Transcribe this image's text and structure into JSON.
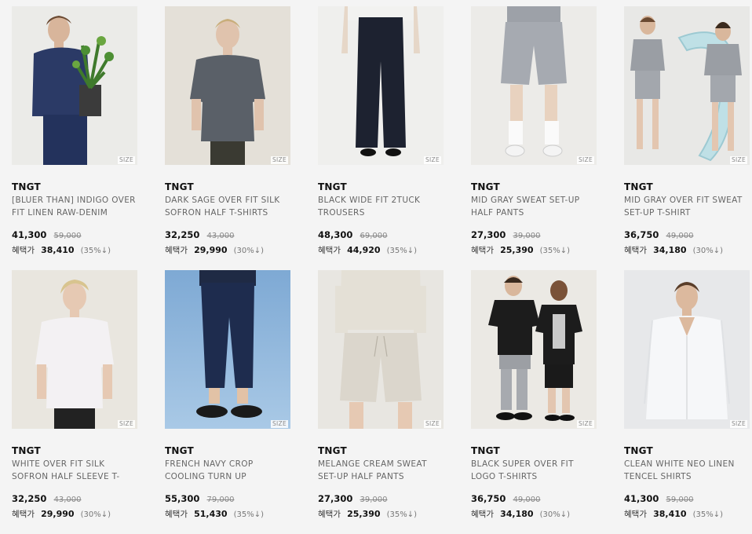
{
  "size_label": "SIZE",
  "products": [
    {
      "brand": "TNGT",
      "name_line1": "[BLUER THAN] INDIGO OVER",
      "name_line2": "FIT LINEN RAW-DENIM",
      "price": "41,300",
      "original_price": "59,000",
      "benefit_label": "혜택가",
      "benefit_price": "38,410",
      "benefit_rate": "(35%↓)"
    },
    {
      "brand": "TNGT",
      "name_line1": "DARK SAGE OVER FIT SILK",
      "name_line2": "SOFRON HALF T-SHIRTS",
      "price": "32,250",
      "original_price": "43,000",
      "benefit_label": "혜택가",
      "benefit_price": "29,990",
      "benefit_rate": "(30%↓)"
    },
    {
      "brand": "TNGT",
      "name_line1": "BLACK WIDE FIT 2TUCK",
      "name_line2": "TROUSERS",
      "price": "48,300",
      "original_price": "69,000",
      "benefit_label": "혜택가",
      "benefit_price": "44,920",
      "benefit_rate": "(35%↓)"
    },
    {
      "brand": "TNGT",
      "name_line1": "MID GRAY SWEAT SET-UP",
      "name_line2": "HALF PANTS",
      "price": "27,300",
      "original_price": "39,000",
      "benefit_label": "혜택가",
      "benefit_price": "25,390",
      "benefit_rate": "(35%↓)"
    },
    {
      "brand": "TNGT",
      "name_line1": "MID GRAY OVER FIT SWEAT",
      "name_line2": "SET-UP T-SHIRT",
      "price": "36,750",
      "original_price": "49,000",
      "benefit_label": "혜택가",
      "benefit_price": "34,180",
      "benefit_rate": "(30%↓)"
    },
    {
      "brand": "TNGT",
      "name_line1": "WHITE OVER FIT SILK",
      "name_line2": "SOFRON HALF SLEEVE T-",
      "price": "32,250",
      "original_price": "43,000",
      "benefit_label": "혜택가",
      "benefit_price": "29,990",
      "benefit_rate": "(30%↓)"
    },
    {
      "brand": "TNGT",
      "name_line1": "FRENCH NAVY CROP",
      "name_line2": "COOLING TURN UP",
      "price": "55,300",
      "original_price": "79,000",
      "benefit_label": "혜택가",
      "benefit_price": "51,430",
      "benefit_rate": "(35%↓)"
    },
    {
      "brand": "TNGT",
      "name_line1": "MELANGE CREAM SWEAT",
      "name_line2": "SET-UP HALF PANTS",
      "price": "27,300",
      "original_price": "39,000",
      "benefit_label": "혜택가",
      "benefit_price": "25,390",
      "benefit_rate": "(35%↓)"
    },
    {
      "brand": "TNGT",
      "name_line1": "BLACK SUPER OVER FIT",
      "name_line2": "LOGO T-SHIRTS",
      "price": "36,750",
      "original_price": "49,000",
      "benefit_label": "혜택가",
      "benefit_price": "34,180",
      "benefit_rate": "(30%↓)"
    },
    {
      "brand": "TNGT",
      "name_line1": "CLEAN WHITE NEO LINEN",
      "name_line2": "TENCEL SHIRTS",
      "price": "41,300",
      "original_price": "59,000",
      "benefit_label": "혜택가",
      "benefit_price": "38,410",
      "benefit_rate": "(35%↓)"
    }
  ]
}
